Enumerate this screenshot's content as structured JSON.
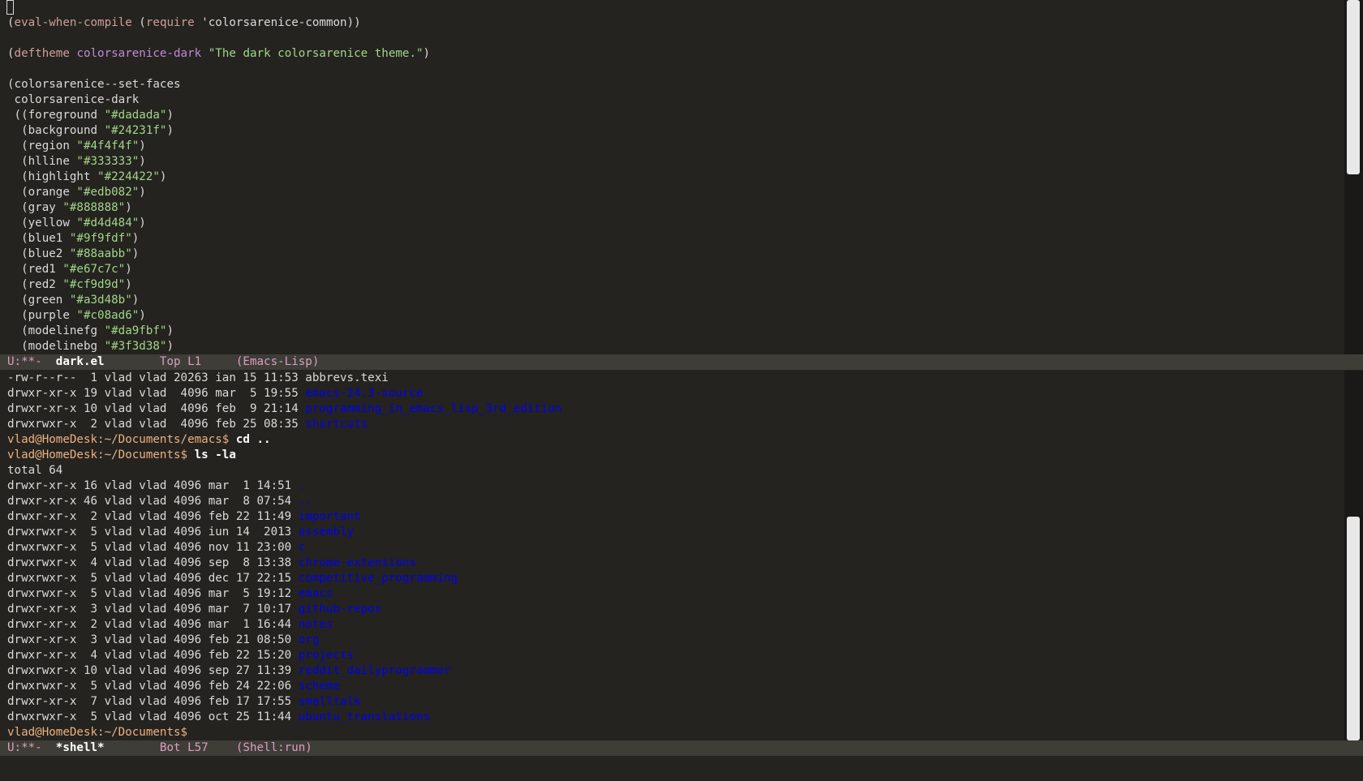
{
  "editor": {
    "lines": [
      {
        "segments": [
          {
            "t": "(",
            "c": "txt"
          },
          {
            "t": "eval-when-compile",
            "c": "kw"
          },
          {
            "t": " (",
            "c": "txt"
          },
          {
            "t": "require",
            "c": "kw"
          },
          {
            "t": " 'colorsarenice-common))",
            "c": "txt"
          }
        ]
      },
      {
        "segments": []
      },
      {
        "segments": [
          {
            "t": "(",
            "c": "txt"
          },
          {
            "t": "deftheme",
            "c": "kw"
          },
          {
            "t": " ",
            "c": "txt"
          },
          {
            "t": "colorsarenice-dark",
            "c": "fn"
          },
          {
            "t": " ",
            "c": "txt"
          },
          {
            "t": "\"The dark colorsarenice theme.\"",
            "c": "str"
          },
          {
            "t": ")",
            "c": "txt"
          }
        ]
      },
      {
        "segments": []
      },
      {
        "segments": [
          {
            "t": "(colorsarenice--set-faces",
            "c": "txt"
          }
        ]
      },
      {
        "segments": [
          {
            "t": " colorsarenice-dark",
            "c": "txt"
          }
        ]
      },
      {
        "segments": [
          {
            "t": " ((foreground ",
            "c": "txt"
          },
          {
            "t": "\"#dadada\"",
            "c": "str"
          },
          {
            "t": ")",
            "c": "txt"
          }
        ]
      },
      {
        "segments": [
          {
            "t": "  (background ",
            "c": "txt"
          },
          {
            "t": "\"#24231f\"",
            "c": "str"
          },
          {
            "t": ")",
            "c": "txt"
          }
        ]
      },
      {
        "segments": [
          {
            "t": "  (region ",
            "c": "txt"
          },
          {
            "t": "\"#4f4f4f\"",
            "c": "str"
          },
          {
            "t": ")",
            "c": "txt"
          }
        ]
      },
      {
        "segments": [
          {
            "t": "  (hlline ",
            "c": "txt"
          },
          {
            "t": "\"#333333\"",
            "c": "str"
          },
          {
            "t": ")",
            "c": "txt"
          }
        ]
      },
      {
        "segments": [
          {
            "t": "  (highlight ",
            "c": "txt"
          },
          {
            "t": "\"#224422\"",
            "c": "str"
          },
          {
            "t": ")",
            "c": "txt"
          }
        ]
      },
      {
        "segments": [
          {
            "t": "  (orange ",
            "c": "txt"
          },
          {
            "t": "\"#edb082\"",
            "c": "str"
          },
          {
            "t": ")",
            "c": "txt"
          }
        ]
      },
      {
        "segments": [
          {
            "t": "  (gray ",
            "c": "txt"
          },
          {
            "t": "\"#888888\"",
            "c": "str"
          },
          {
            "t": ")",
            "c": "txt"
          }
        ]
      },
      {
        "segments": [
          {
            "t": "  (yellow ",
            "c": "txt"
          },
          {
            "t": "\"#d4d484\"",
            "c": "str"
          },
          {
            "t": ")",
            "c": "txt"
          }
        ]
      },
      {
        "segments": [
          {
            "t": "  (blue1 ",
            "c": "txt"
          },
          {
            "t": "\"#9f9fdf\"",
            "c": "str"
          },
          {
            "t": ")",
            "c": "txt"
          }
        ]
      },
      {
        "segments": [
          {
            "t": "  (blue2 ",
            "c": "txt"
          },
          {
            "t": "\"#88aabb\"",
            "c": "str"
          },
          {
            "t": ")",
            "c": "txt"
          }
        ]
      },
      {
        "segments": [
          {
            "t": "  (red1 ",
            "c": "txt"
          },
          {
            "t": "\"#e67c7c\"",
            "c": "str"
          },
          {
            "t": ")",
            "c": "txt"
          }
        ]
      },
      {
        "segments": [
          {
            "t": "  (red2 ",
            "c": "txt"
          },
          {
            "t": "\"#cf9d9d\"",
            "c": "str"
          },
          {
            "t": ")",
            "c": "txt"
          }
        ]
      },
      {
        "segments": [
          {
            "t": "  (green ",
            "c": "txt"
          },
          {
            "t": "\"#a3d48b\"",
            "c": "str"
          },
          {
            "t": ")",
            "c": "txt"
          }
        ]
      },
      {
        "segments": [
          {
            "t": "  (purple ",
            "c": "txt"
          },
          {
            "t": "\"#c08ad6\"",
            "c": "str"
          },
          {
            "t": ")",
            "c": "txt"
          }
        ]
      },
      {
        "segments": [
          {
            "t": "  (modelinefg ",
            "c": "txt"
          },
          {
            "t": "\"#da9fbf\"",
            "c": "str"
          },
          {
            "t": ")",
            "c": "txt"
          }
        ]
      },
      {
        "segments": [
          {
            "t": "  (modelinebg ",
            "c": "txt"
          },
          {
            "t": "\"#3f3d38\"",
            "c": "str"
          },
          {
            "t": ")",
            "c": "txt"
          }
        ]
      }
    ]
  },
  "modeline_top": {
    "status": "U:**-  ",
    "buffer": "dark.el",
    "position": "        Top L1     ",
    "mode": "(Emacs-Lisp)"
  },
  "shell": {
    "lines": [
      {
        "segments": [
          {
            "t": "-rw-r--r--  1 vlad vlad 20263 ian 15 11:53 abbrevs.texi",
            "c": "txt"
          }
        ]
      },
      {
        "segments": [
          {
            "t": "drwxr-xr-x 19 vlad vlad  4096 mar  5 19:55 ",
            "c": "txt"
          },
          {
            "t": "emacs-24.3-source",
            "c": "dir"
          }
        ]
      },
      {
        "segments": [
          {
            "t": "drwxr-xr-x 10 vlad vlad  4096 feb  9 21:14 ",
            "c": "txt"
          },
          {
            "t": "programming_in_emacs_lisp_3rd_edition",
            "c": "dir"
          }
        ]
      },
      {
        "segments": [
          {
            "t": "drwxrwxr-x  2 vlad vlad  4096 feb 25 08:35 ",
            "c": "txt"
          },
          {
            "t": "shortcuts",
            "c": "dir"
          }
        ]
      },
      {
        "segments": [
          {
            "t": "vlad@HomeDesk:~/Documents/emacs$ ",
            "c": "prompt"
          },
          {
            "t": "cd ..",
            "c": "cmd"
          }
        ]
      },
      {
        "segments": [
          {
            "t": "vlad@HomeDesk:~/Documents$ ",
            "c": "prompt"
          },
          {
            "t": "ls -la",
            "c": "cmd"
          }
        ]
      },
      {
        "segments": [
          {
            "t": "total 64",
            "c": "txt"
          }
        ]
      },
      {
        "segments": [
          {
            "t": "drwxr-xr-x 16 vlad vlad 4096 mar  1 14:51 ",
            "c": "txt"
          },
          {
            "t": ".",
            "c": "dir"
          }
        ]
      },
      {
        "segments": [
          {
            "t": "drwxr-xr-x 46 vlad vlad 4096 mar  8 07:54 ",
            "c": "txt"
          },
          {
            "t": "..",
            "c": "dir"
          }
        ]
      },
      {
        "segments": [
          {
            "t": "drwxr-xr-x  2 vlad vlad 4096 feb 22 11:49 ",
            "c": "txt"
          },
          {
            "t": "important",
            "c": "dir"
          }
        ]
      },
      {
        "segments": [
          {
            "t": "drwxrwxr-x  5 vlad vlad 4096 iun 14  2013 ",
            "c": "txt"
          },
          {
            "t": "assembly",
            "c": "dir"
          }
        ]
      },
      {
        "segments": [
          {
            "t": "drwxrwxr-x  5 vlad vlad 4096 nov 11 23:00 ",
            "c": "txt"
          },
          {
            "t": "c",
            "c": "dir"
          }
        ]
      },
      {
        "segments": [
          {
            "t": "drwxrwxr-x  4 vlad vlad 4096 sep  8 13:38 ",
            "c": "txt"
          },
          {
            "t": "chrome-extensions",
            "c": "dir"
          }
        ]
      },
      {
        "segments": [
          {
            "t": "drwxrwxr-x  5 vlad vlad 4096 dec 17 22:15 ",
            "c": "txt"
          },
          {
            "t": "competitive_programming",
            "c": "dir"
          }
        ]
      },
      {
        "segments": [
          {
            "t": "drwxrwxr-x  5 vlad vlad 4096 mar  5 19:12 ",
            "c": "txt"
          },
          {
            "t": "emacs",
            "c": "dir"
          }
        ]
      },
      {
        "segments": [
          {
            "t": "drwxr-xr-x  3 vlad vlad 4096 mar  7 10:17 ",
            "c": "txt"
          },
          {
            "t": "github-repos",
            "c": "dir"
          }
        ]
      },
      {
        "segments": [
          {
            "t": "drwxr-xr-x  2 vlad vlad 4096 mar  1 16:44 ",
            "c": "txt"
          },
          {
            "t": "notes",
            "c": "dir"
          }
        ]
      },
      {
        "segments": [
          {
            "t": "drwxr-xr-x  3 vlad vlad 4096 feb 21 08:50 ",
            "c": "txt"
          },
          {
            "t": "org",
            "c": "dir"
          }
        ]
      },
      {
        "segments": [
          {
            "t": "drwxr-xr-x  4 vlad vlad 4096 feb 22 15:20 ",
            "c": "txt"
          },
          {
            "t": "projects",
            "c": "dir"
          }
        ]
      },
      {
        "segments": [
          {
            "t": "drwxrwxr-x 10 vlad vlad 4096 sep 27 11:39 ",
            "c": "txt"
          },
          {
            "t": "reddit_dailyprogrammer",
            "c": "dir"
          }
        ]
      },
      {
        "segments": [
          {
            "t": "drwxrwxr-x  5 vlad vlad 4096 feb 24 22:06 ",
            "c": "txt"
          },
          {
            "t": "scheme",
            "c": "dir"
          }
        ]
      },
      {
        "segments": [
          {
            "t": "drwxr-xr-x  7 vlad vlad 4096 feb 17 17:55 ",
            "c": "txt"
          },
          {
            "t": "smalltalk",
            "c": "dir"
          }
        ]
      },
      {
        "segments": [
          {
            "t": "drwxrwxr-x  5 vlad vlad 4096 oct 25 11:44 ",
            "c": "txt"
          },
          {
            "t": "ubuntu_translations",
            "c": "dir"
          }
        ]
      },
      {
        "segments": [
          {
            "t": "vlad@HomeDesk:~/Documents$",
            "c": "prompt"
          }
        ]
      }
    ]
  },
  "modeline_bottom": {
    "status": "U:**-  ",
    "buffer": "*shell*",
    "position": "        Bot L57    ",
    "mode": "(Shell:run)"
  },
  "colors": {
    "foreground": "#dadada",
    "background": "#24231f",
    "modeline_fg": "#da9fbf",
    "modeline_bg": "#3f3d38",
    "directory": "#0000ee"
  }
}
